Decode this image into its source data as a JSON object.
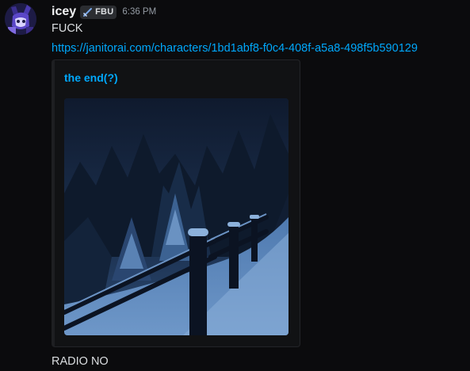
{
  "message": {
    "author": {
      "name": "icey",
      "tag": "FBU",
      "tag_icon": "sword-icon",
      "avatar": "avatar-icon",
      "color": "#f2f3f5"
    },
    "timestamp": "6:36 PM",
    "text": "FUCK",
    "link": "https://janitorai.com/characters/1bd1abf8-f0c4-408f-a5a8-498f5b590129",
    "link_color": "#00a8fc",
    "embed": {
      "title": "the end(?)",
      "image": "snowy-fence-night-image"
    },
    "followup_text": "RADIO NO"
  }
}
